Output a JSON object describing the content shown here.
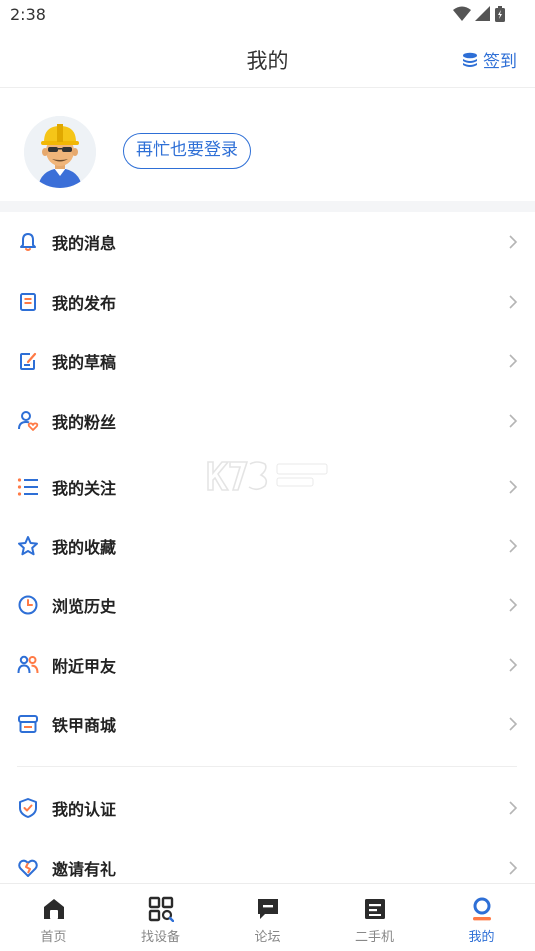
{
  "status_bar": {
    "time": "2:38"
  },
  "header": {
    "title": "我的",
    "checkin_label": "签到"
  },
  "profile": {
    "login_label": "再忙也要登录"
  },
  "menu_items": [
    {
      "label": "我的消息",
      "icon": "bell-icon"
    },
    {
      "label": "我的发布",
      "icon": "document-icon"
    },
    {
      "label": "我的草稿",
      "icon": "draft-edit-icon"
    },
    {
      "label": "我的粉丝",
      "icon": "fans-icon"
    },
    {
      "label": "我的关注",
      "icon": "list-icon"
    },
    {
      "label": "我的收藏",
      "icon": "star-icon"
    },
    {
      "label": "浏览历史",
      "icon": "clock-icon"
    },
    {
      "label": "附近甲友",
      "icon": "people-icon"
    },
    {
      "label": "铁甲商城",
      "icon": "shop-icon"
    },
    {
      "label": "我的认证",
      "icon": "shield-check-icon"
    },
    {
      "label": "邀请有礼",
      "icon": "heart-icon"
    }
  ],
  "bottom_nav": [
    {
      "label": "首页",
      "icon": "home-icon"
    },
    {
      "label": "找设备",
      "icon": "find-device-icon"
    },
    {
      "label": "论坛",
      "icon": "forum-icon"
    },
    {
      "label": "二手机",
      "icon": "used-machine-icon"
    },
    {
      "label": "我的",
      "icon": "profile-icon",
      "active": true
    }
  ],
  "colors": {
    "accent": "#2e6fd6",
    "orange": "#ff7a45",
    "text": "#222222",
    "muted": "#888888"
  }
}
